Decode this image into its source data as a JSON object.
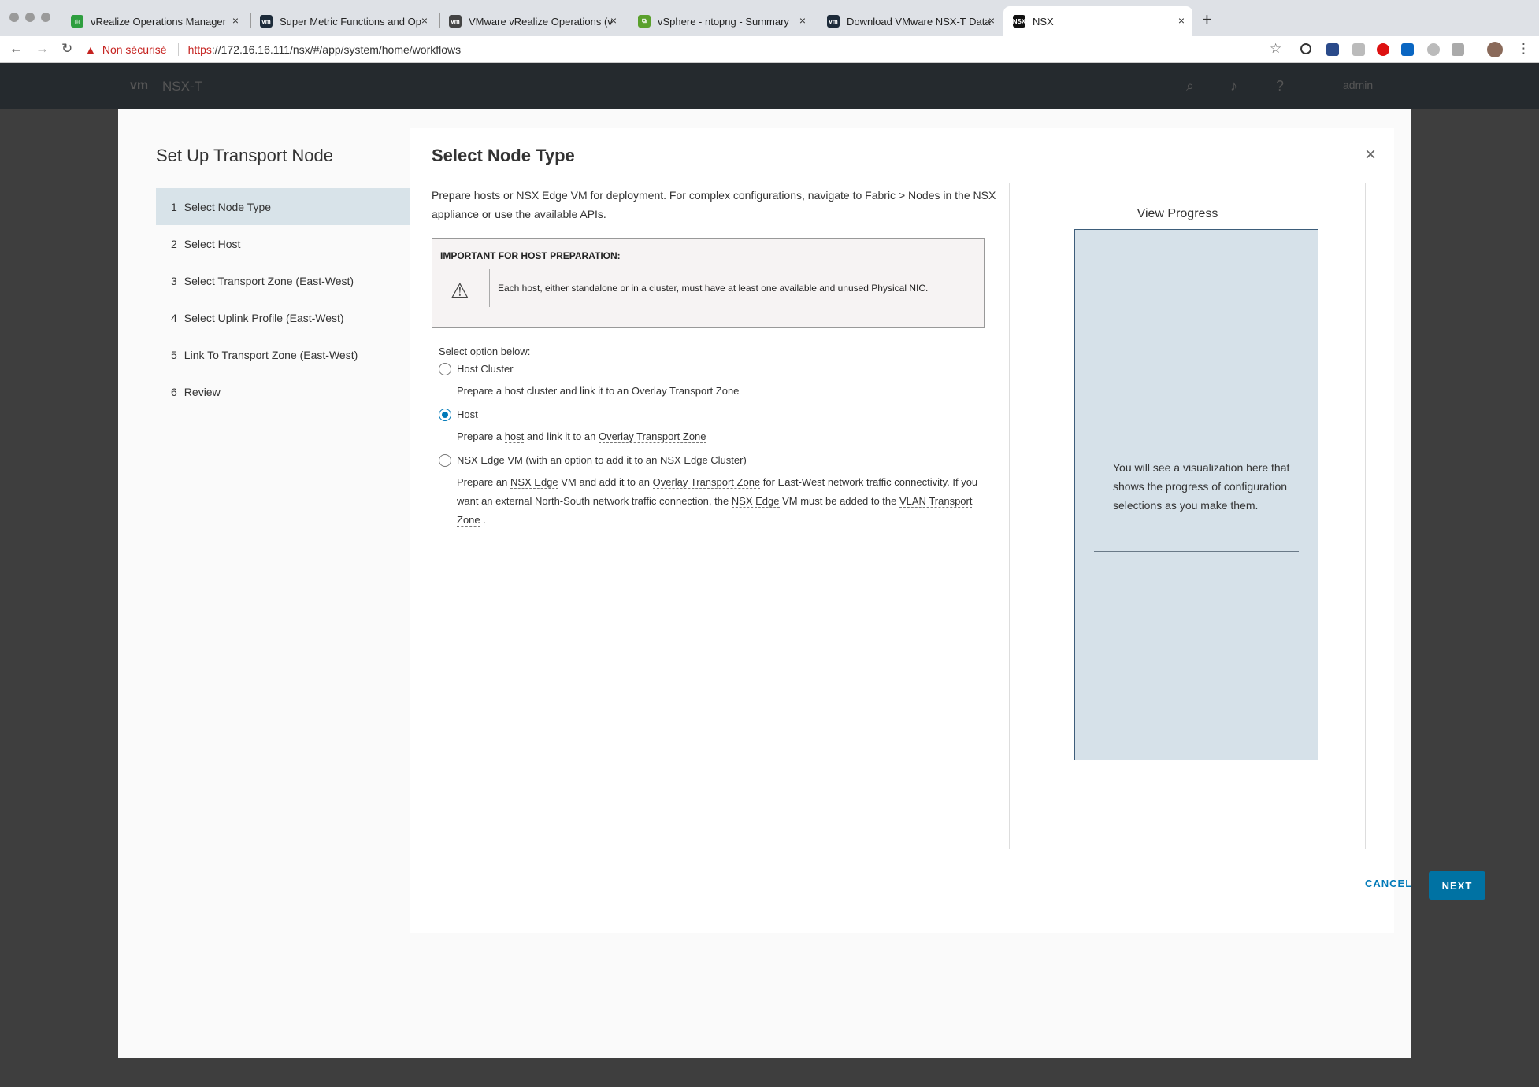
{
  "browser": {
    "tabs": [
      {
        "label": "vRealize Operations Manager",
        "icon": "vrops-icon",
        "color": "#2e9e3f"
      },
      {
        "label": "Super Metric Functions and Op",
        "icon": "vm-icon",
        "color": "#1d2b3a"
      },
      {
        "label": "VMware vRealize Operations (v",
        "icon": "vm-icon",
        "color": "#444"
      },
      {
        "label": "vSphere - ntopng - Summary",
        "icon": "vsphere-icon",
        "color": "#5aa02c"
      },
      {
        "label": "Download VMware NSX-T Data",
        "icon": "vm-icon",
        "color": "#1d2b3a"
      },
      {
        "label": "NSX",
        "icon": "nsx-icon",
        "color": "#111"
      }
    ],
    "new_tab": "+",
    "address": {
      "warning_label": "Non sécurisé",
      "scheme": "https",
      "rest": "://172.16.16.111/nsx/#/app/system/home/workflows"
    }
  },
  "app_header": {
    "logo": "vm",
    "title": "NSX-T",
    "user": "admin"
  },
  "wizard": {
    "title": "Set Up Transport Node",
    "steps": [
      {
        "num": "1",
        "label": "Select Node Type"
      },
      {
        "num": "2",
        "label": "Select Host"
      },
      {
        "num": "3",
        "label": "Select Transport Zone (East-West)"
      },
      {
        "num": "4",
        "label": "Select Uplink Profile (East-West)"
      },
      {
        "num": "5",
        "label": "Link To Transport Zone (East-West)"
      },
      {
        "num": "6",
        "label": "Review"
      }
    ],
    "active_step": 1
  },
  "page": {
    "title": "Select Node Type",
    "close_label": "×",
    "intro": "Prepare hosts or NSX Edge VM for deployment. For complex configurations, navigate to Fabric > Nodes in the NSX appliance or use the available APIs.",
    "alert": {
      "heading": "IMPORTANT FOR HOST PREPARATION:",
      "text": "Each host, either standalone or in a cluster, must have at least one available and unused Physical NIC."
    },
    "options_label": "Select option below:",
    "options": [
      {
        "title": "Host Cluster",
        "checked": false,
        "desc": {
          "p1": "Prepare a ",
          "u1": "host cluster",
          "p2": " and link it to an ",
          "u2": "Overlay Transport Zone"
        }
      },
      {
        "title": "Host",
        "checked": true,
        "desc": {
          "p1": "Prepare a ",
          "u1": "host",
          "p2": " and link it to an ",
          "u2": "Overlay Transport Zone"
        }
      },
      {
        "title": "NSX Edge VM (with an option to add it to an NSX Edge Cluster)",
        "checked": false,
        "desc": {
          "p1": "Prepare an ",
          "u1": "NSX Edge",
          "p2": " VM and add it to an ",
          "u2": "Overlay Transport Zone",
          "p3": " for East-West network traffic connectivity. If you want an external North-South network traffic connection, the ",
          "u3": "NSX Edge",
          "p4": " VM must be added to the ",
          "u4": "VLAN Transport Zone",
          "p5": " ."
        }
      }
    ],
    "progress": {
      "title": "View Progress",
      "text": "You will see a visualization here that shows the progress of configuration selections as you make them."
    },
    "buttons": {
      "cancel": "CANCEL",
      "next": "NEXT"
    }
  },
  "colors": {
    "primary": "#0072a3",
    "link": "#0079b8",
    "active_step_bg": "#d8e3e9",
    "progress_box_bg": "#d6e1e9",
    "warning": "#c5221f"
  }
}
